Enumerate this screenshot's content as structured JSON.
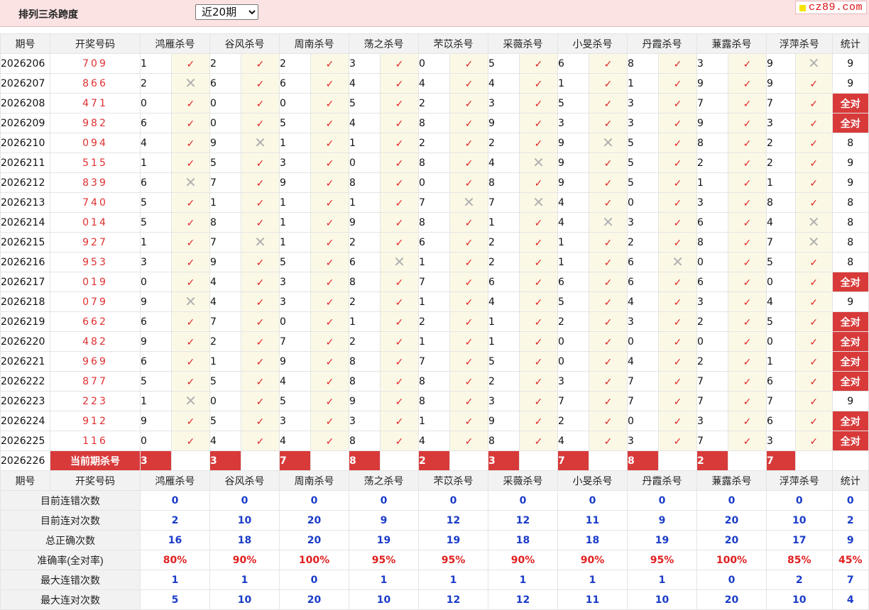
{
  "header": {
    "title": "排列三杀跨度",
    "period_selected": "近20期",
    "logo_text": "cz89.com"
  },
  "columns": {
    "issue": "期号",
    "draw": "开奖号码",
    "experts": [
      "鸿雁杀号",
      "谷风杀号",
      "周南杀号",
      "荡之杀号",
      "芣苡杀号",
      "采薇杀号",
      "小旻杀号",
      "丹霞杀号",
      "蒹露杀号",
      "浮萍杀号"
    ],
    "stat": "统计"
  },
  "marks": {
    "ok": "✓",
    "no": "✕"
  },
  "rows": [
    {
      "issue": "2026206",
      "draw": "709",
      "kills": [
        [
          1,
          1
        ],
        [
          2,
          1
        ],
        [
          2,
          1
        ],
        [
          3,
          1
        ],
        [
          0,
          1
        ],
        [
          5,
          1
        ],
        [
          6,
          1
        ],
        [
          8,
          1
        ],
        [
          3,
          1
        ],
        [
          9,
          0
        ]
      ],
      "stat": "9"
    },
    {
      "issue": "2026207",
      "draw": "866",
      "kills": [
        [
          2,
          0
        ],
        [
          6,
          1
        ],
        [
          6,
          1
        ],
        [
          4,
          1
        ],
        [
          4,
          1
        ],
        [
          4,
          1
        ],
        [
          1,
          1
        ],
        [
          1,
          1
        ],
        [
          9,
          1
        ],
        [
          9,
          1
        ]
      ],
      "stat": "9"
    },
    {
      "issue": "2026208",
      "draw": "471",
      "kills": [
        [
          0,
          1
        ],
        [
          0,
          1
        ],
        [
          0,
          1
        ],
        [
          5,
          1
        ],
        [
          2,
          1
        ],
        [
          3,
          1
        ],
        [
          5,
          1
        ],
        [
          3,
          1
        ],
        [
          7,
          1
        ],
        [
          7,
          1
        ]
      ],
      "stat": "全对"
    },
    {
      "issue": "2026209",
      "draw": "982",
      "kills": [
        [
          6,
          1
        ],
        [
          0,
          1
        ],
        [
          5,
          1
        ],
        [
          4,
          1
        ],
        [
          8,
          1
        ],
        [
          9,
          1
        ],
        [
          3,
          1
        ],
        [
          3,
          1
        ],
        [
          9,
          1
        ],
        [
          3,
          1
        ]
      ],
      "stat": "全对"
    },
    {
      "issue": "2026210",
      "draw": "094",
      "kills": [
        [
          4,
          1
        ],
        [
          9,
          0
        ],
        [
          1,
          1
        ],
        [
          1,
          1
        ],
        [
          2,
          1
        ],
        [
          2,
          1
        ],
        [
          9,
          0
        ],
        [
          5,
          1
        ],
        [
          8,
          1
        ],
        [
          2,
          1
        ]
      ],
      "stat": "8"
    },
    {
      "issue": "2026211",
      "draw": "515",
      "kills": [
        [
          1,
          1
        ],
        [
          5,
          1
        ],
        [
          3,
          1
        ],
        [
          0,
          1
        ],
        [
          8,
          1
        ],
        [
          4,
          0
        ],
        [
          9,
          1
        ],
        [
          5,
          1
        ],
        [
          2,
          1
        ],
        [
          2,
          1
        ]
      ],
      "stat": "9"
    },
    {
      "issue": "2026212",
      "draw": "839",
      "kills": [
        [
          6,
          0
        ],
        [
          7,
          1
        ],
        [
          9,
          1
        ],
        [
          8,
          1
        ],
        [
          0,
          1
        ],
        [
          8,
          1
        ],
        [
          9,
          1
        ],
        [
          5,
          1
        ],
        [
          1,
          1
        ],
        [
          1,
          1
        ]
      ],
      "stat": "9"
    },
    {
      "issue": "2026213",
      "draw": "740",
      "kills": [
        [
          5,
          1
        ],
        [
          1,
          1
        ],
        [
          1,
          1
        ],
        [
          1,
          1
        ],
        [
          7,
          0
        ],
        [
          7,
          0
        ],
        [
          4,
          1
        ],
        [
          0,
          1
        ],
        [
          3,
          1
        ],
        [
          8,
          1
        ]
      ],
      "stat": "8"
    },
    {
      "issue": "2026214",
      "draw": "014",
      "kills": [
        [
          5,
          1
        ],
        [
          8,
          1
        ],
        [
          1,
          1
        ],
        [
          9,
          1
        ],
        [
          8,
          1
        ],
        [
          1,
          1
        ],
        [
          4,
          0
        ],
        [
          3,
          1
        ],
        [
          6,
          1
        ],
        [
          4,
          0
        ]
      ],
      "stat": "8"
    },
    {
      "issue": "2026215",
      "draw": "927",
      "kills": [
        [
          1,
          1
        ],
        [
          7,
          0
        ],
        [
          1,
          1
        ],
        [
          2,
          1
        ],
        [
          6,
          1
        ],
        [
          2,
          1
        ],
        [
          1,
          1
        ],
        [
          2,
          1
        ],
        [
          8,
          1
        ],
        [
          7,
          0
        ]
      ],
      "stat": "8"
    },
    {
      "issue": "2026216",
      "draw": "953",
      "kills": [
        [
          3,
          1
        ],
        [
          9,
          1
        ],
        [
          5,
          1
        ],
        [
          6,
          0
        ],
        [
          1,
          1
        ],
        [
          2,
          1
        ],
        [
          1,
          1
        ],
        [
          6,
          0
        ],
        [
          0,
          1
        ],
        [
          5,
          1
        ]
      ],
      "stat": "8"
    },
    {
      "issue": "2026217",
      "draw": "019",
      "kills": [
        [
          0,
          1
        ],
        [
          4,
          1
        ],
        [
          3,
          1
        ],
        [
          8,
          1
        ],
        [
          7,
          1
        ],
        [
          6,
          1
        ],
        [
          6,
          1
        ],
        [
          6,
          1
        ],
        [
          6,
          1
        ],
        [
          0,
          1
        ]
      ],
      "stat": "全对"
    },
    {
      "issue": "2026218",
      "draw": "079",
      "kills": [
        [
          9,
          0
        ],
        [
          4,
          1
        ],
        [
          3,
          1
        ],
        [
          2,
          1
        ],
        [
          1,
          1
        ],
        [
          4,
          1
        ],
        [
          5,
          1
        ],
        [
          4,
          1
        ],
        [
          3,
          1
        ],
        [
          4,
          1
        ]
      ],
      "stat": "9"
    },
    {
      "issue": "2026219",
      "draw": "662",
      "kills": [
        [
          6,
          1
        ],
        [
          7,
          1
        ],
        [
          0,
          1
        ],
        [
          1,
          1
        ],
        [
          2,
          1
        ],
        [
          1,
          1
        ],
        [
          2,
          1
        ],
        [
          3,
          1
        ],
        [
          2,
          1
        ],
        [
          5,
          1
        ]
      ],
      "stat": "全对"
    },
    {
      "issue": "2026220",
      "draw": "482",
      "kills": [
        [
          9,
          1
        ],
        [
          2,
          1
        ],
        [
          7,
          1
        ],
        [
          2,
          1
        ],
        [
          1,
          1
        ],
        [
          1,
          1
        ],
        [
          0,
          1
        ],
        [
          0,
          1
        ],
        [
          0,
          1
        ],
        [
          0,
          1
        ]
      ],
      "stat": "全对"
    },
    {
      "issue": "2026221",
      "draw": "969",
      "kills": [
        [
          6,
          1
        ],
        [
          1,
          1
        ],
        [
          9,
          1
        ],
        [
          8,
          1
        ],
        [
          7,
          1
        ],
        [
          5,
          1
        ],
        [
          0,
          1
        ],
        [
          4,
          1
        ],
        [
          2,
          1
        ],
        [
          1,
          1
        ]
      ],
      "stat": "全对"
    },
    {
      "issue": "2026222",
      "draw": "877",
      "kills": [
        [
          5,
          1
        ],
        [
          5,
          1
        ],
        [
          4,
          1
        ],
        [
          8,
          1
        ],
        [
          8,
          1
        ],
        [
          2,
          1
        ],
        [
          3,
          1
        ],
        [
          7,
          1
        ],
        [
          7,
          1
        ],
        [
          6,
          1
        ]
      ],
      "stat": "全对"
    },
    {
      "issue": "2026223",
      "draw": "223",
      "kills": [
        [
          1,
          0
        ],
        [
          0,
          1
        ],
        [
          5,
          1
        ],
        [
          9,
          1
        ],
        [
          8,
          1
        ],
        [
          3,
          1
        ],
        [
          7,
          1
        ],
        [
          7,
          1
        ],
        [
          7,
          1
        ],
        [
          7,
          1
        ]
      ],
      "stat": "9"
    },
    {
      "issue": "2026224",
      "draw": "912",
      "kills": [
        [
          9,
          1
        ],
        [
          5,
          1
        ],
        [
          3,
          1
        ],
        [
          3,
          1
        ],
        [
          1,
          1
        ],
        [
          9,
          1
        ],
        [
          2,
          1
        ],
        [
          0,
          1
        ],
        [
          3,
          1
        ],
        [
          6,
          1
        ]
      ],
      "stat": "全对"
    },
    {
      "issue": "2026225",
      "draw": "116",
      "kills": [
        [
          0,
          1
        ],
        [
          4,
          1
        ],
        [
          4,
          1
        ],
        [
          8,
          1
        ],
        [
          4,
          1
        ],
        [
          8,
          1
        ],
        [
          4,
          1
        ],
        [
          3,
          1
        ],
        [
          7,
          1
        ],
        [
          3,
          1
        ]
      ],
      "stat": "全对"
    }
  ],
  "current": {
    "issue": "2026226",
    "label": "当前期杀号",
    "kills": [
      "3",
      "3",
      "7",
      "8",
      "2",
      "3",
      "7",
      "8",
      "2",
      "7"
    ]
  },
  "summary": [
    {
      "label": "目前连错次数",
      "values": [
        "0",
        "0",
        "0",
        "0",
        "0",
        "0",
        "0",
        "0",
        "0",
        "0"
      ],
      "stat": "0"
    },
    {
      "label": "目前连对次数",
      "values": [
        "2",
        "10",
        "20",
        "9",
        "12",
        "12",
        "11",
        "9",
        "20",
        "10"
      ],
      "stat": "2"
    },
    {
      "label": "总正确次数",
      "values": [
        "16",
        "18",
        "20",
        "19",
        "19",
        "18",
        "18",
        "19",
        "20",
        "17"
      ],
      "stat": "9"
    },
    {
      "label": "准确率(全对率)",
      "values": [
        "80%",
        "90%",
        "100%",
        "95%",
        "95%",
        "90%",
        "90%",
        "95%",
        "100%",
        "85%"
      ],
      "stat": "45%",
      "rate": true
    },
    {
      "label": "最大连错次数",
      "values": [
        "1",
        "1",
        "0",
        "1",
        "1",
        "1",
        "1",
        "1",
        "0",
        "2"
      ],
      "stat": "7"
    },
    {
      "label": "最大连对次数",
      "values": [
        "5",
        "10",
        "20",
        "10",
        "12",
        "12",
        "11",
        "10",
        "20",
        "10"
      ],
      "stat": "4"
    }
  ]
}
